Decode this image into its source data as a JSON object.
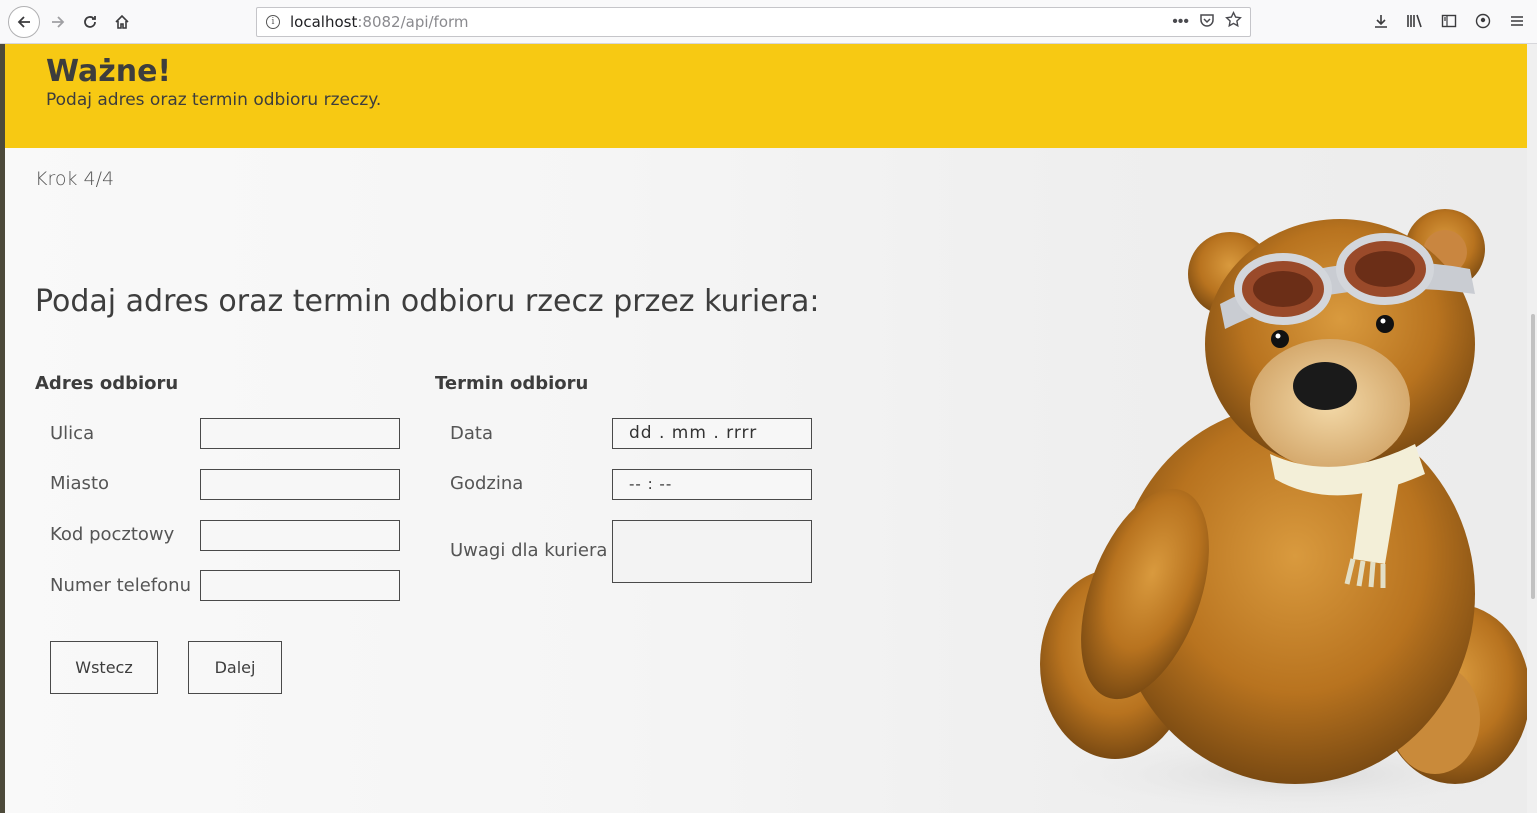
{
  "browser": {
    "url_host": "localhost",
    "url_path": ":8082/api/form",
    "url_more": "•••"
  },
  "banner": {
    "title": "Ważne!",
    "subtitle": "Podaj adres oraz termin odbioru rzeczy."
  },
  "step": "Krok 4/4",
  "heading": "Podaj adres oraz termin odbioru rzecz przez kuriera:",
  "address": {
    "title": "Adres odbioru",
    "street_label": "Ulica",
    "city_label": "Miasto",
    "postal_label": "Kod pocztowy",
    "phone_label": "Numer telefonu"
  },
  "schedule": {
    "title": "Termin odbioru",
    "date_label": "Data",
    "date_value": "dd . mm . rrrr",
    "time_label": "Godzina",
    "time_value": "-- : --",
    "notes_label": "Uwagi dla kuriera"
  },
  "buttons": {
    "back": "Wstecz",
    "next": "Dalej"
  },
  "colors": {
    "banner": "#f7c913",
    "text": "#3d3d3d"
  }
}
